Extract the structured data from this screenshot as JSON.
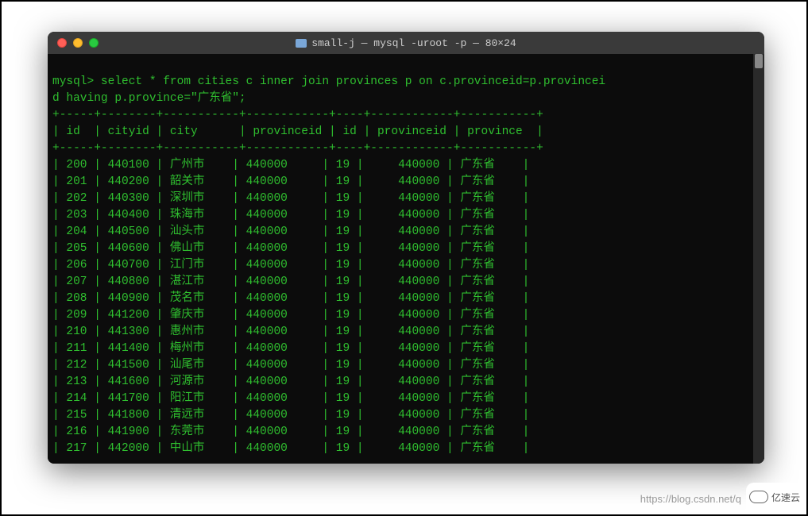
{
  "window": {
    "title": "small-j — mysql -uroot -p — 80×24"
  },
  "prompt": "mysql> ",
  "query_line1": "select * from cities c inner join provinces p on c.provinceid=p.provincei",
  "query_line2": "d having p.province=\"广东省\";",
  "table": {
    "separator": "+-----+--------+-----------+------------+----+------------+-----------+",
    "header_row": "| id  | cityid | city      | provinceid | id | provinceid | province  |",
    "columns": [
      "id",
      "cityid",
      "city",
      "provinceid",
      "id",
      "provinceid",
      "province"
    ],
    "rows": [
      {
        "id": "200",
        "cityid": "440100",
        "city": "广州市",
        "pid": "440000",
        "id2": "19",
        "pid2": "440000",
        "prov": "广东省"
      },
      {
        "id": "201",
        "cityid": "440200",
        "city": "韶关市",
        "pid": "440000",
        "id2": "19",
        "pid2": "440000",
        "prov": "广东省"
      },
      {
        "id": "202",
        "cityid": "440300",
        "city": "深圳市",
        "pid": "440000",
        "id2": "19",
        "pid2": "440000",
        "prov": "广东省"
      },
      {
        "id": "203",
        "cityid": "440400",
        "city": "珠海市",
        "pid": "440000",
        "id2": "19",
        "pid2": "440000",
        "prov": "广东省"
      },
      {
        "id": "204",
        "cityid": "440500",
        "city": "汕头市",
        "pid": "440000",
        "id2": "19",
        "pid2": "440000",
        "prov": "广东省"
      },
      {
        "id": "205",
        "cityid": "440600",
        "city": "佛山市",
        "pid": "440000",
        "id2": "19",
        "pid2": "440000",
        "prov": "广东省"
      },
      {
        "id": "206",
        "cityid": "440700",
        "city": "江门市",
        "pid": "440000",
        "id2": "19",
        "pid2": "440000",
        "prov": "广东省"
      },
      {
        "id": "207",
        "cityid": "440800",
        "city": "湛江市",
        "pid": "440000",
        "id2": "19",
        "pid2": "440000",
        "prov": "广东省"
      },
      {
        "id": "208",
        "cityid": "440900",
        "city": "茂名市",
        "pid": "440000",
        "id2": "19",
        "pid2": "440000",
        "prov": "广东省"
      },
      {
        "id": "209",
        "cityid": "441200",
        "city": "肇庆市",
        "pid": "440000",
        "id2": "19",
        "pid2": "440000",
        "prov": "广东省"
      },
      {
        "id": "210",
        "cityid": "441300",
        "city": "惠州市",
        "pid": "440000",
        "id2": "19",
        "pid2": "440000",
        "prov": "广东省"
      },
      {
        "id": "211",
        "cityid": "441400",
        "city": "梅州市",
        "pid": "440000",
        "id2": "19",
        "pid2": "440000",
        "prov": "广东省"
      },
      {
        "id": "212",
        "cityid": "441500",
        "city": "汕尾市",
        "pid": "440000",
        "id2": "19",
        "pid2": "440000",
        "prov": "广东省"
      },
      {
        "id": "213",
        "cityid": "441600",
        "city": "河源市",
        "pid": "440000",
        "id2": "19",
        "pid2": "440000",
        "prov": "广东省"
      },
      {
        "id": "214",
        "cityid": "441700",
        "city": "阳江市",
        "pid": "440000",
        "id2": "19",
        "pid2": "440000",
        "prov": "广东省"
      },
      {
        "id": "215",
        "cityid": "441800",
        "city": "清远市",
        "pid": "440000",
        "id2": "19",
        "pid2": "440000",
        "prov": "广东省"
      },
      {
        "id": "216",
        "cityid": "441900",
        "city": "东莞市",
        "pid": "440000",
        "id2": "19",
        "pid2": "440000",
        "prov": "广东省"
      },
      {
        "id": "217",
        "cityid": "442000",
        "city": "中山市",
        "pid": "440000",
        "id2": "19",
        "pid2": "440000",
        "prov": "广东省"
      }
    ]
  },
  "watermark": "https://blog.csdn.net/q",
  "corner_logo_text": "亿速云"
}
